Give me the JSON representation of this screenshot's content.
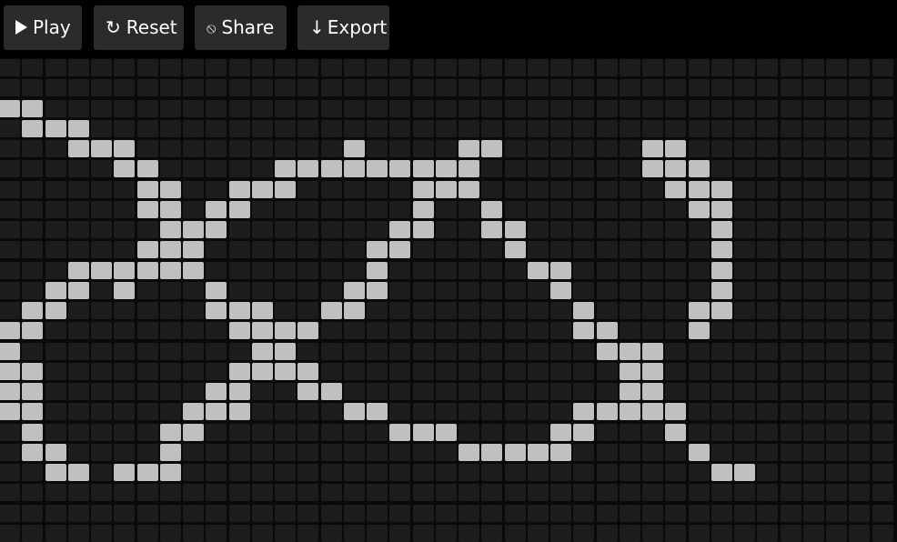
{
  "toolbar": {
    "play_label": "Play",
    "reset_label": "Reset",
    "share_label": "Share",
    "export_label": "Export",
    "play_icon": "play-icon",
    "reset_icon_glyph": "↻",
    "share_icon_glyph": "⦸",
    "export_icon_glyph": "↓"
  },
  "colors": {
    "background": "#000000",
    "button_bg": "#2b2b2b",
    "button_text": "#ffffff",
    "cell_dead": "#1d1d1d",
    "cell_alive": "#c0c0c0"
  },
  "board": {
    "columns": 39,
    "rows": 21,
    "alive_cells": [
      [
        2,
        0
      ],
      [
        2,
        1
      ],
      [
        3,
        1
      ],
      [
        3,
        2
      ],
      [
        3,
        3
      ],
      [
        4,
        3
      ],
      [
        4,
        4
      ],
      [
        4,
        5
      ],
      [
        4,
        15
      ],
      [
        4,
        20
      ],
      [
        4,
        21
      ],
      [
        4,
        28
      ],
      [
        4,
        29
      ],
      [
        5,
        5
      ],
      [
        5,
        6
      ],
      [
        5,
        12
      ],
      [
        5,
        13
      ],
      [
        5,
        14
      ],
      [
        5,
        15
      ],
      [
        5,
        16
      ],
      [
        5,
        17
      ],
      [
        5,
        18
      ],
      [
        5,
        19
      ],
      [
        5,
        20
      ],
      [
        5,
        28
      ],
      [
        5,
        29
      ],
      [
        5,
        30
      ],
      [
        6,
        6
      ],
      [
        6,
        7
      ],
      [
        6,
        10
      ],
      [
        6,
        11
      ],
      [
        6,
        12
      ],
      [
        6,
        18
      ],
      [
        6,
        19
      ],
      [
        6,
        20
      ],
      [
        6,
        29
      ],
      [
        6,
        30
      ],
      [
        6,
        31
      ],
      [
        7,
        6
      ],
      [
        7,
        7
      ],
      [
        7,
        9
      ],
      [
        7,
        10
      ],
      [
        7,
        18
      ],
      [
        7,
        21
      ],
      [
        7,
        30
      ],
      [
        7,
        31
      ],
      [
        8,
        7
      ],
      [
        8,
        8
      ],
      [
        8,
        9
      ],
      [
        8,
        17
      ],
      [
        8,
        18
      ],
      [
        8,
        21
      ],
      [
        8,
        22
      ],
      [
        8,
        31
      ],
      [
        9,
        6
      ],
      [
        9,
        7
      ],
      [
        9,
        8
      ],
      [
        9,
        16
      ],
      [
        9,
        17
      ],
      [
        9,
        22
      ],
      [
        9,
        31
      ],
      [
        10,
        3
      ],
      [
        10,
        4
      ],
      [
        10,
        5
      ],
      [
        10,
        6
      ],
      [
        10,
        7
      ],
      [
        10,
        8
      ],
      [
        10,
        16
      ],
      [
        10,
        23
      ],
      [
        10,
        24
      ],
      [
        10,
        31
      ],
      [
        11,
        2
      ],
      [
        11,
        3
      ],
      [
        11,
        5
      ],
      [
        11,
        9
      ],
      [
        11,
        15
      ],
      [
        11,
        16
      ],
      [
        11,
        24
      ],
      [
        11,
        31
      ],
      [
        12,
        1
      ],
      [
        12,
        2
      ],
      [
        12,
        9
      ],
      [
        12,
        10
      ],
      [
        12,
        11
      ],
      [
        12,
        14
      ],
      [
        12,
        15
      ],
      [
        12,
        25
      ],
      [
        12,
        30
      ],
      [
        12,
        31
      ],
      [
        13,
        0
      ],
      [
        13,
        1
      ],
      [
        13,
        10
      ],
      [
        13,
        11
      ],
      [
        13,
        12
      ],
      [
        13,
        13
      ],
      [
        13,
        25
      ],
      [
        13,
        26
      ],
      [
        13,
        30
      ],
      [
        14,
        0
      ],
      [
        14,
        11
      ],
      [
        14,
        12
      ],
      [
        14,
        26
      ],
      [
        14,
        27
      ],
      [
        14,
        28
      ],
      [
        15,
        0
      ],
      [
        15,
        1
      ],
      [
        15,
        10
      ],
      [
        15,
        11
      ],
      [
        15,
        12
      ],
      [
        15,
        13
      ],
      [
        15,
        27
      ],
      [
        15,
        28
      ],
      [
        16,
        0
      ],
      [
        16,
        1
      ],
      [
        16,
        9
      ],
      [
        16,
        10
      ],
      [
        16,
        13
      ],
      [
        16,
        14
      ],
      [
        16,
        27
      ],
      [
        16,
        28
      ],
      [
        17,
        0
      ],
      [
        17,
        1
      ],
      [
        17,
        8
      ],
      [
        17,
        9
      ],
      [
        17,
        10
      ],
      [
        17,
        15
      ],
      [
        17,
        16
      ],
      [
        17,
        25
      ],
      [
        17,
        26
      ],
      [
        17,
        27
      ],
      [
        17,
        28
      ],
      [
        17,
        29
      ],
      [
        18,
        1
      ],
      [
        18,
        7
      ],
      [
        18,
        8
      ],
      [
        18,
        17
      ],
      [
        18,
        18
      ],
      [
        18,
        19
      ],
      [
        18,
        24
      ],
      [
        18,
        25
      ],
      [
        18,
        29
      ],
      [
        19,
        1
      ],
      [
        19,
        2
      ],
      [
        19,
        7
      ],
      [
        19,
        20
      ],
      [
        19,
        21
      ],
      [
        19,
        22
      ],
      [
        19,
        23
      ],
      [
        19,
        24
      ],
      [
        19,
        30
      ],
      [
        20,
        2
      ],
      [
        20,
        3
      ],
      [
        20,
        5
      ],
      [
        20,
        6
      ],
      [
        20,
        7
      ],
      [
        20,
        31
      ],
      [
        20,
        32
      ]
    ]
  }
}
